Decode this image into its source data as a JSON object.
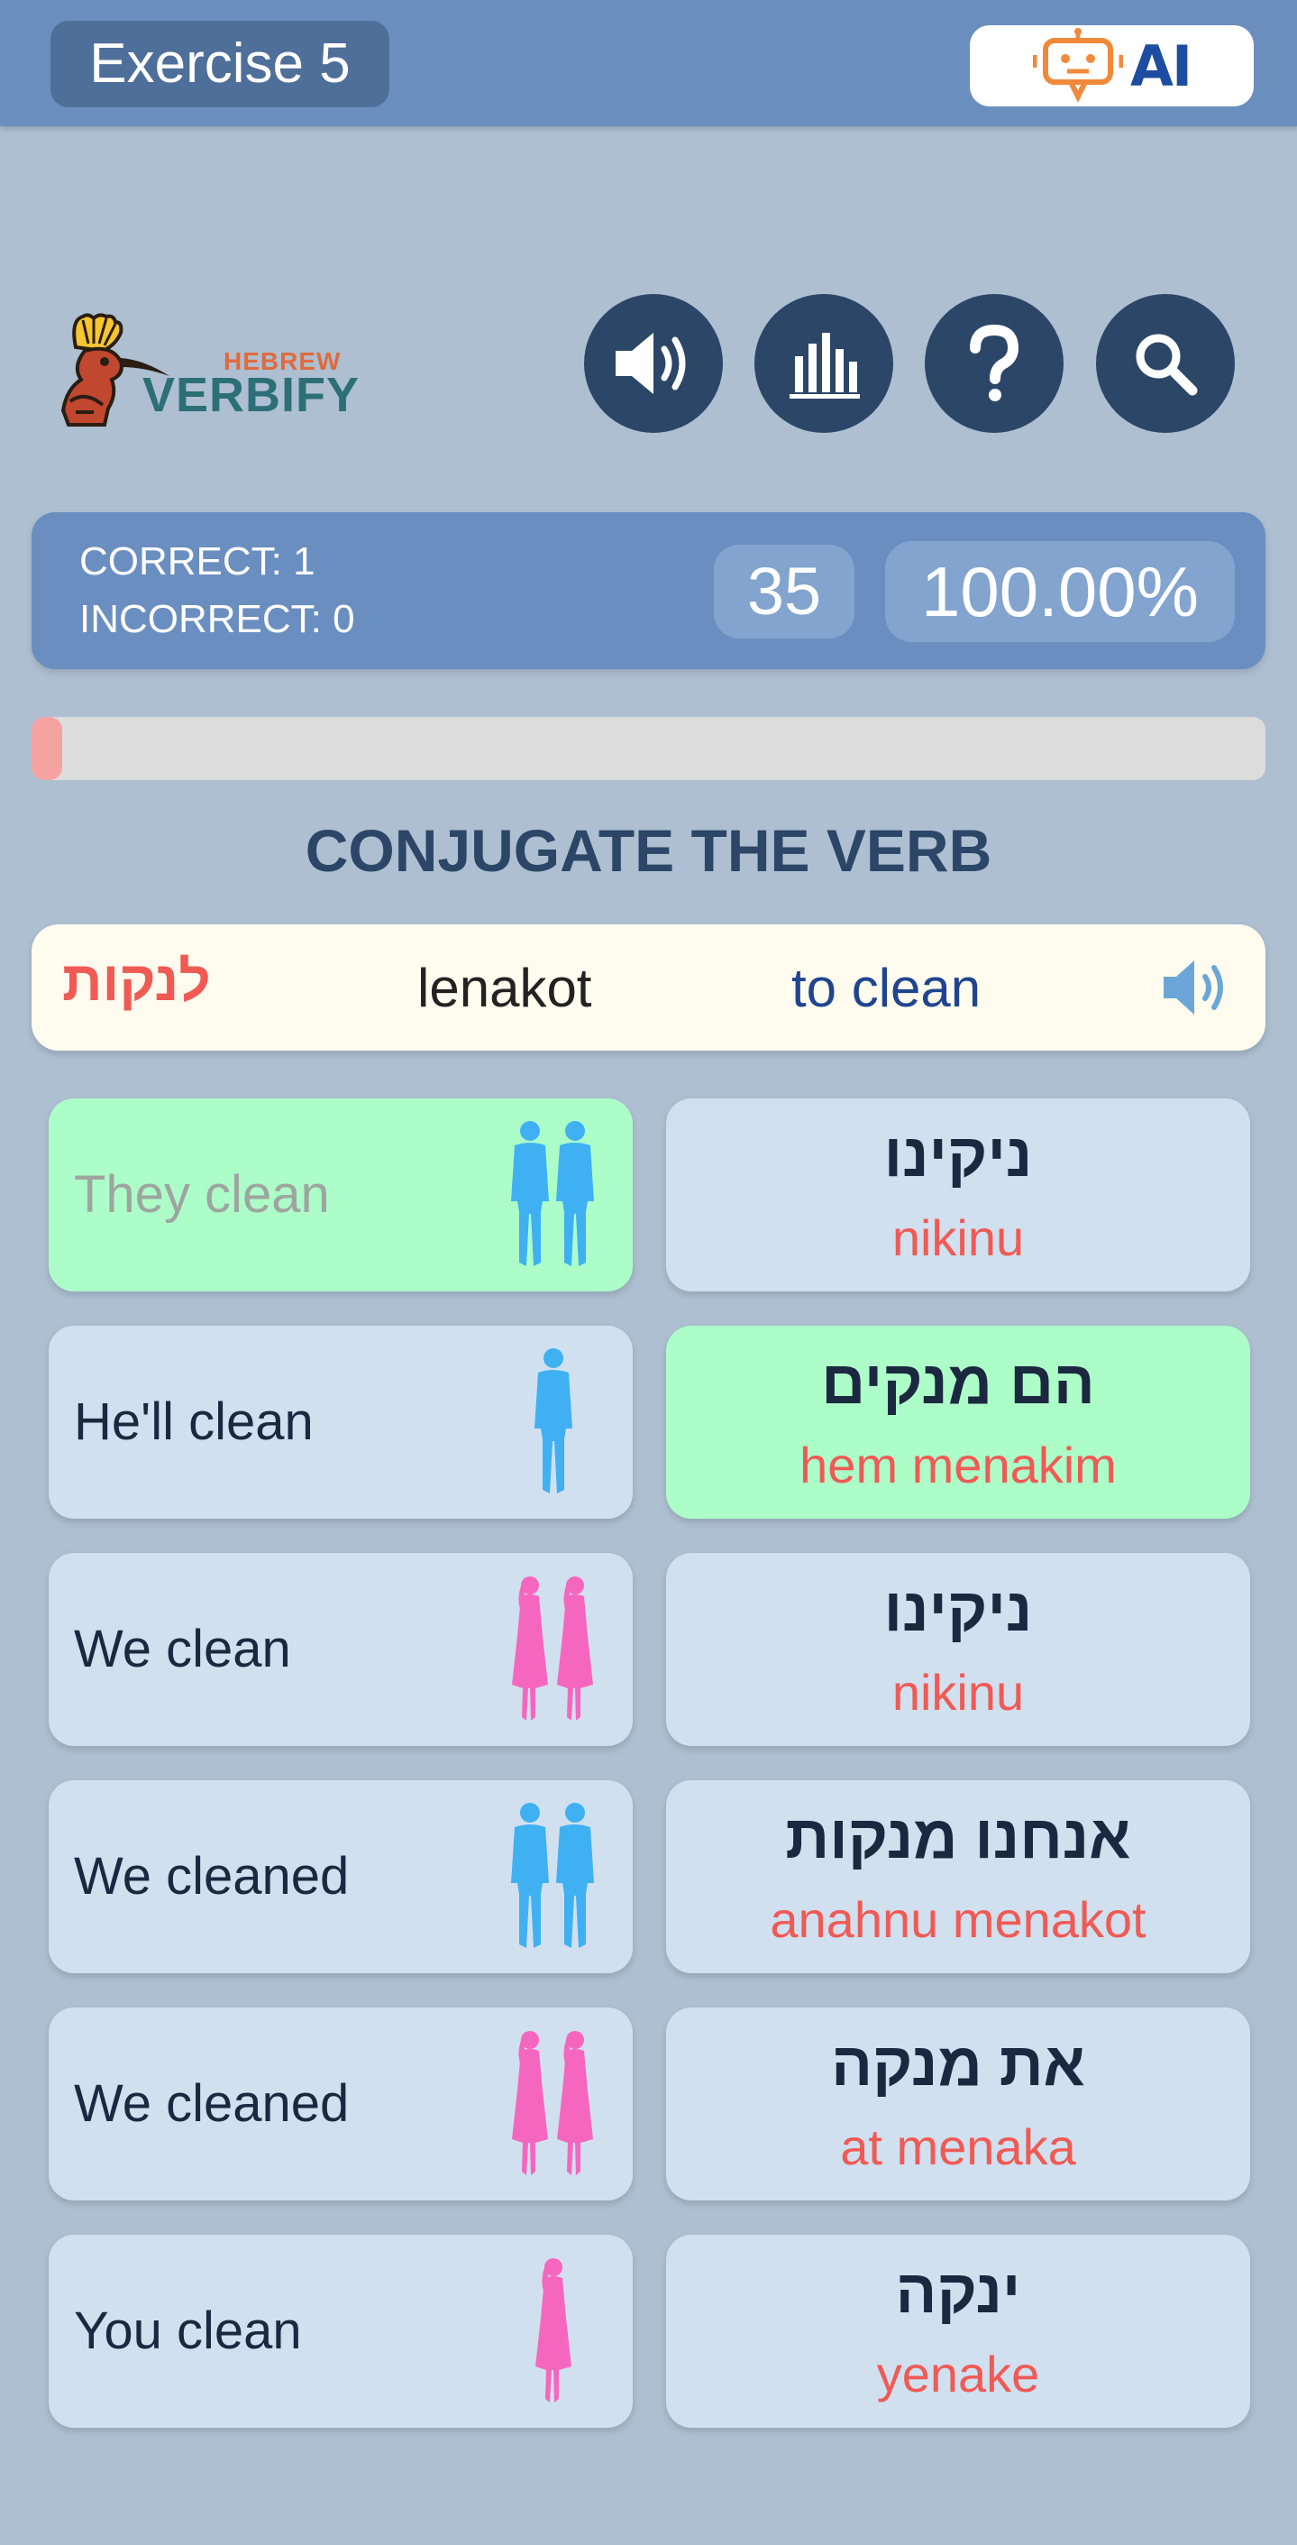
{
  "header": {
    "exercise_label": "Exercise 5",
    "ai_button_label": "AI"
  },
  "logo": {
    "small_text": "HEBREW",
    "large_text": "VERBIFY"
  },
  "toolbar": {
    "icons": [
      "speaker-icon",
      "stats-bar-chart-icon",
      "help-question-icon",
      "search-icon"
    ]
  },
  "score": {
    "correct": "CORRECT: 1",
    "incorrect": "INCORRECT: 0",
    "timer": "35",
    "percent": "100.00%"
  },
  "progress": {
    "value": 0.025,
    "color": "#f4a3a0"
  },
  "task": {
    "heading": "CONJUGATE THE VERB"
  },
  "verb": {
    "hebrew": "לנקות",
    "transliteration": "lenakot",
    "english": "to clean"
  },
  "english_options": [
    {
      "label": "They clean",
      "figure": "two-men-icon",
      "color": "#3fb1f3",
      "selected": true
    },
    {
      "label": "He'll clean",
      "figure": "one-man-icon",
      "color": "#3fb1f3",
      "selected": false
    },
    {
      "label": "We clean",
      "figure": "two-women-icon",
      "color": "#f567be",
      "selected": false
    },
    {
      "label": "We cleaned",
      "figure": "two-men-icon",
      "color": "#3fb1f3",
      "selected": false
    },
    {
      "label": "We cleaned",
      "figure": "two-women-icon",
      "color": "#f567be",
      "selected": false
    },
    {
      "label": "You clean",
      "figure": "one-woman-icon",
      "color": "#f567be",
      "selected": false
    }
  ],
  "hebrew_options": [
    {
      "hebrew": "ניקינו",
      "transliteration": "nikinu",
      "selected": false
    },
    {
      "hebrew": "הם מנקים",
      "transliteration": "hem menakim",
      "selected": true
    },
    {
      "hebrew": "ניקינו",
      "transliteration": "nikinu",
      "selected": false
    },
    {
      "hebrew": "אנחנו מנקות",
      "transliteration": "anahnu menakot",
      "selected": false
    },
    {
      "hebrew": "את מנקה",
      "transliteration": "at menaka",
      "selected": false
    },
    {
      "hebrew": "ינקה",
      "transliteration": "yenake",
      "selected": false
    }
  ],
  "colors": {
    "background": "#adbfd1",
    "header": "#6a8fbf",
    "accent_dark": "#2c4668",
    "selected_tile": "#adfdc9",
    "tile": "#d1e0ef",
    "transliteration_red": "#f05a55",
    "male_figure": "#3fb1f3",
    "female_figure": "#f567be"
  }
}
